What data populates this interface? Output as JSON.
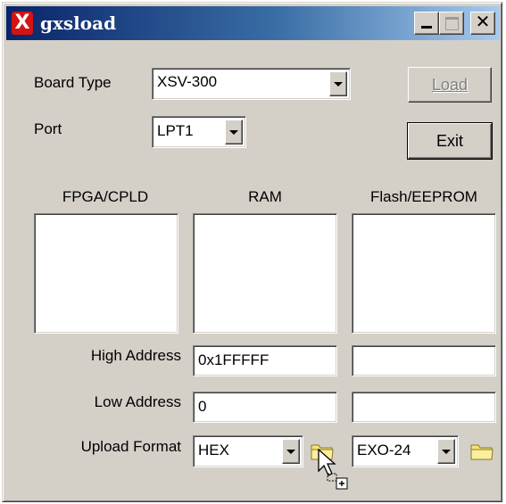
{
  "window": {
    "title": "gxsload",
    "icon": "x-logo-icon",
    "controls": {
      "minimize_icon": "minimize-icon",
      "maximize_icon": "maximize-icon",
      "close_label": "✕"
    }
  },
  "board_type": {
    "label": "Board Type",
    "value": "XSV-300"
  },
  "port": {
    "label": "Port",
    "value": "LPT1"
  },
  "buttons": {
    "load": "Load",
    "exit": "Exit"
  },
  "columns": {
    "fpga": "FPGA/CPLD",
    "ram": "RAM",
    "flash": "Flash/EEPROM"
  },
  "addresses": {
    "high_label": "High Address",
    "low_label": "Low Address",
    "ram_high": "0x1FFFFF",
    "ram_low": "0",
    "flash_high": "",
    "flash_low": ""
  },
  "upload": {
    "label": "Upload Format",
    "ram_format": "HEX",
    "flash_format": "EXO-24"
  },
  "colors": {
    "face": "#d4d0c8",
    "title_start": "#0a246a",
    "title_end": "#a6caf0",
    "icon_red": "#d21414",
    "folder_yellow": "#f5e27a"
  }
}
